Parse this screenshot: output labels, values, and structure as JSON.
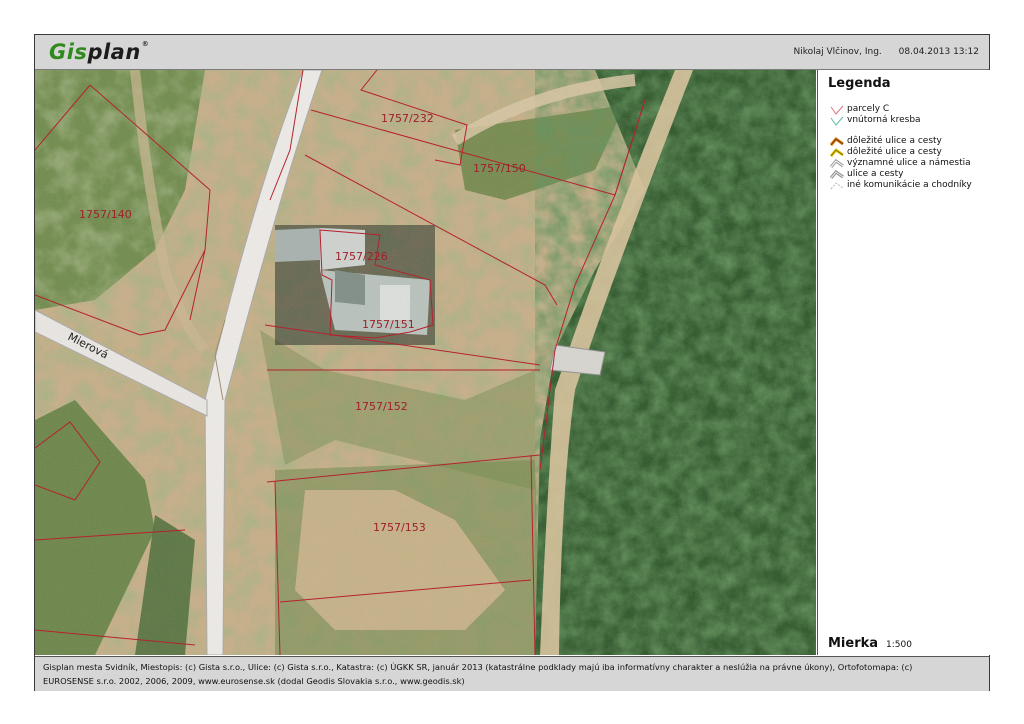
{
  "header": {
    "logo_part1": "Gis",
    "logo_part2": "plan",
    "logo_mark": "®",
    "user": "Nikolaj Vlčinov, Ing.",
    "datetime": "08.04.2013 13:12",
    "background_color": "#d6d6d6",
    "logo_color": "#2f8a1e"
  },
  "map": {
    "street_label": "Mierová",
    "parcel_line_color": "#b5222e",
    "parcels": [
      {
        "id": "p232",
        "label": "1757/232"
      },
      {
        "id": "p150",
        "label": "1757/150"
      },
      {
        "id": "p140",
        "label": "1757/140"
      },
      {
        "id": "p226",
        "label": "1757/226"
      },
      {
        "id": "p151",
        "label": "1757/151"
      },
      {
        "id": "p152",
        "label": "1757/152"
      },
      {
        "id": "p153",
        "label": "1757/153"
      }
    ]
  },
  "legend": {
    "title": "Legenda",
    "items": [
      {
        "label": "parcely C",
        "icon": "parcel-line-icon",
        "color": "#d9747c"
      },
      {
        "label": "vnútorná kresba",
        "icon": "inner-line-icon",
        "color": "#5fb8a8"
      },
      {
        "label": "dôležité ulice a cesty",
        "icon": "important-road-icon",
        "color": "#e07a16"
      },
      {
        "label": "dôležité ulice a cesty",
        "icon": "important-road-yellow-icon",
        "color": "#e6cf1b"
      },
      {
        "label": "významné ulice a námestia",
        "icon": "significant-street-icon",
        "color": "#9a9a9a"
      },
      {
        "label": "ulice a cesty",
        "icon": "street-icon",
        "color": "#8a8a8a"
      },
      {
        "label": "iné komunikácie a chodníky",
        "icon": "path-icon",
        "color": "#b8b8b8"
      }
    ],
    "scale_title": "Mierka",
    "scale_value": "1:500"
  },
  "footer": {
    "line1": "Gisplan mesta Svidník, Miestopis: (c) Gista s.r.o., Ulice: (c) Gista s.r.o., Katastra: (c) ÚGKK SR, január 2013 (katastrálne podklady majú iba informatívny charakter a neslúžia na právne úkony), Ortofotomapa: (c)",
    "line2": "EUROSENSE s.r.o. 2002, 2006, 2009, www.eurosense.sk (dodal Geodis Slovakia s.r.o., www.geodis.sk)"
  }
}
